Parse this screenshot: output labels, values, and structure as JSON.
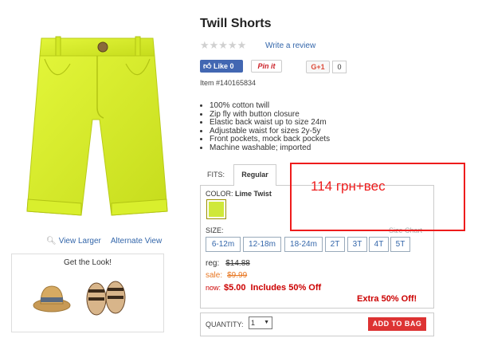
{
  "product": {
    "title": "Twill Shorts",
    "rating_stars": "★★★★★",
    "write_review": "Write a review",
    "item_number": "Item #140165834",
    "image_color": "#d7f025"
  },
  "social": {
    "like_label": "Like 0",
    "pinit_label": "Pin it",
    "gplus_label": "G+1",
    "gplus_count": "0"
  },
  "image_links": {
    "view_larger": "View Larger",
    "alternate_view": "Alternate View"
  },
  "get_the_look": {
    "title": "Get the Look!"
  },
  "features": [
    "100% cotton twill",
    "Zip fly with button closure",
    "Elastic back waist up to size 24m",
    "Adjustable waist for sizes 2y-5y",
    "Front pockets, mock back pockets",
    "Machine washable; imported"
  ],
  "fits": {
    "label": "FITS:",
    "selected": "Regular"
  },
  "color": {
    "label": "COLOR:",
    "selected": "Lime Twist",
    "swatch_hex": "#cfe83a"
  },
  "size": {
    "label": "SIZE:",
    "chart_link": "Size Chart",
    "options": [
      "6-12m",
      "12-18m",
      "18-24m",
      "2T",
      "3T",
      "4T",
      "5T"
    ]
  },
  "pricing": {
    "reg_label": "reg:",
    "reg_price": "$14.88",
    "sale_label": "sale:",
    "sale_price": "$9.99",
    "now_label": "now:",
    "now_price": "$5.00",
    "now_note": "Includes 50% Off",
    "extra_off": "Extra 50% Off!"
  },
  "purchase": {
    "quantity_label": "QUANTITY:",
    "quantity_value": "1",
    "add_to_bag": "ADD TO BAG"
  },
  "annotation": {
    "text": "114 грн+вес",
    "color": "#ee1c1c"
  }
}
